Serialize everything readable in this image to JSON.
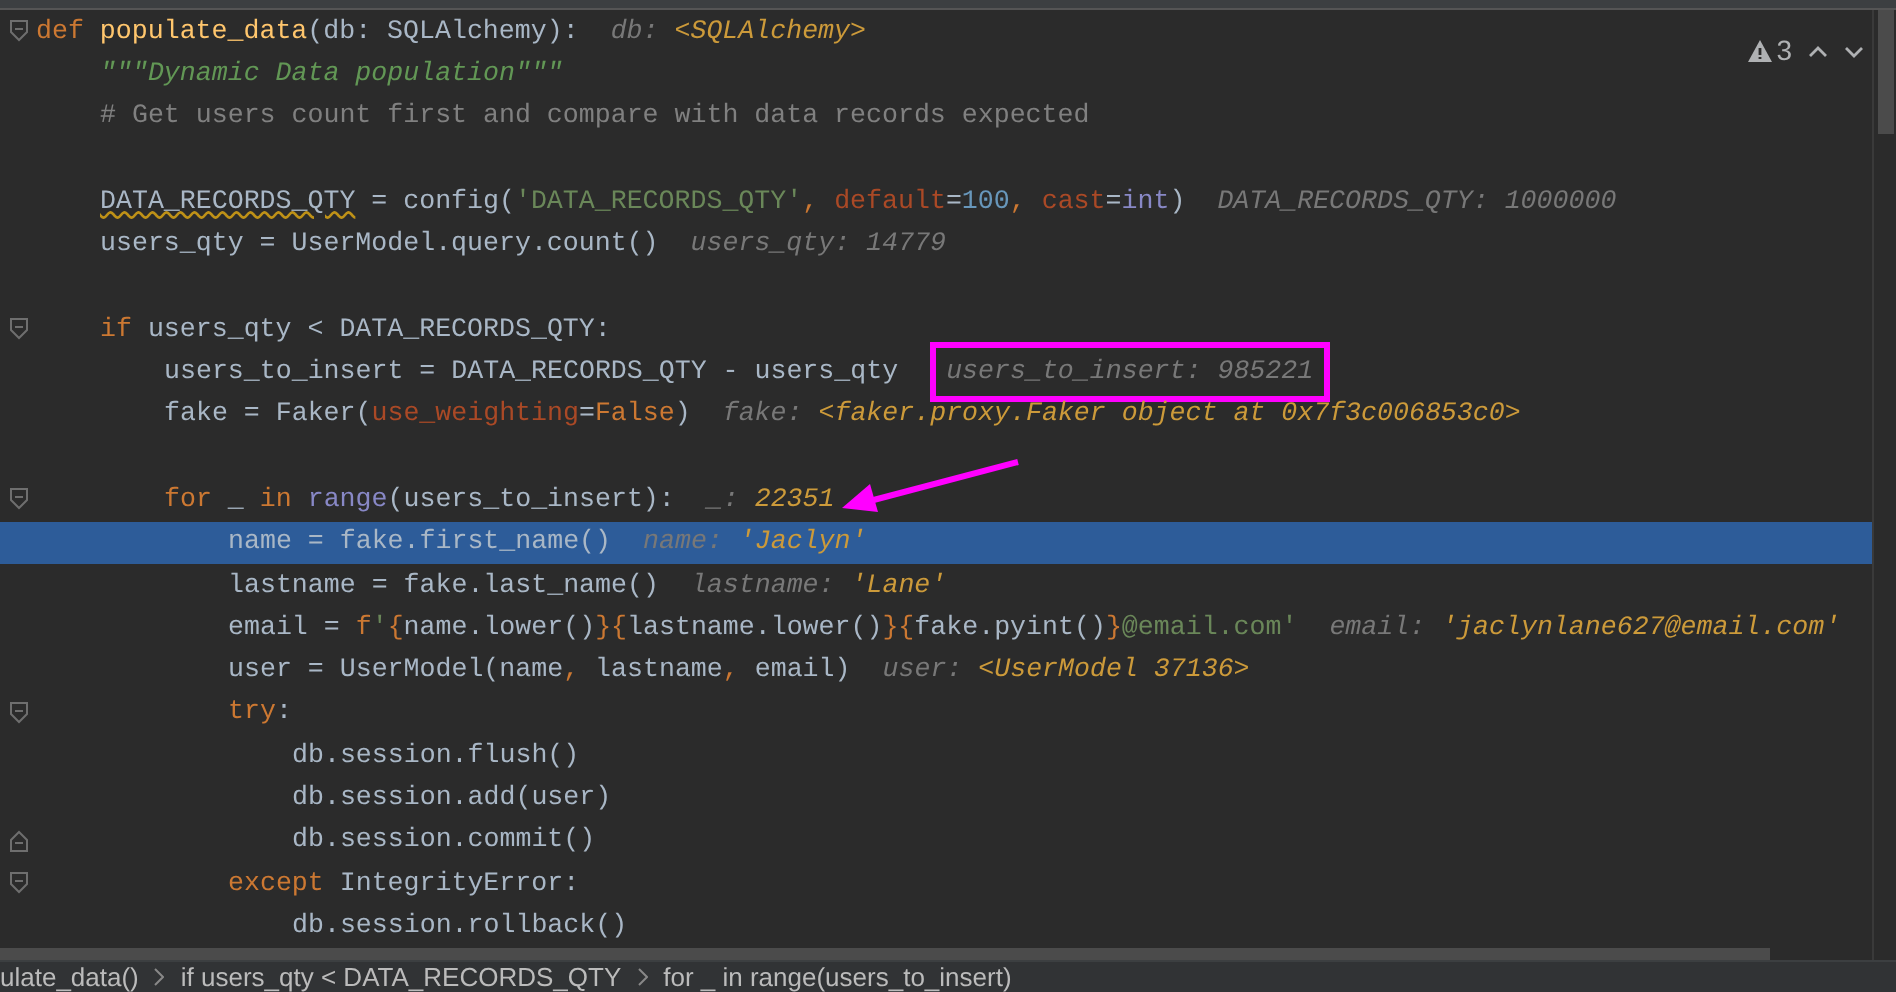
{
  "inspections": {
    "count": "3"
  },
  "lines": [
    {
      "kind": "code",
      "fold_end": false,
      "current": false,
      "tokens": [
        {
          "kind": "keyword",
          "text": "def "
        },
        {
          "kind": "function",
          "text": "populate_data"
        },
        {
          "kind": "plain",
          "text": "(db: SQLAlchemy):"
        }
      ],
      "hint": {
        "boxed": false,
        "arrow": false,
        "parts": [
          {
            "kind": "label",
            "text": "db: "
          },
          {
            "kind": "value",
            "text": "<SQLAlchemy>"
          }
        ]
      },
      "children": [
        {
          "kind": "code",
          "fold_end": false,
          "current": false,
          "tokens": [
            {
              "kind": "docstring",
              "text": "\"\"\"Dynamic Data population\"\"\""
            }
          ]
        },
        {
          "kind": "code",
          "fold_end": false,
          "current": false,
          "tokens": [
            {
              "kind": "comment",
              "text": "# Get users count first and compare with data records expected"
            }
          ]
        },
        {
          "kind": "blank"
        },
        {
          "kind": "code",
          "fold_end": false,
          "current": false,
          "tokens": [
            {
              "kind": "warning",
              "text": "DATA_RECORDS_QTY"
            },
            {
              "kind": "plain",
              "text": " = config("
            },
            {
              "kind": "string",
              "text": "'DATA_RECORDS_QTY'"
            },
            {
              "kind": "keyword",
              "text": ", "
            },
            {
              "kind": "param",
              "text": "default"
            },
            {
              "kind": "plain",
              "text": "="
            },
            {
              "kind": "number",
              "text": "100"
            },
            {
              "kind": "keyword",
              "text": ", "
            },
            {
              "kind": "param",
              "text": "cast"
            },
            {
              "kind": "plain",
              "text": "="
            },
            {
              "kind": "builtin",
              "text": "int"
            },
            {
              "kind": "plain",
              "text": ")"
            }
          ],
          "hint": {
            "boxed": false,
            "arrow": false,
            "parts": [
              {
                "kind": "label",
                "text": "DATA_RECORDS_QTY: 1000000"
              }
            ]
          }
        },
        {
          "kind": "code",
          "fold_end": false,
          "current": false,
          "tokens": [
            {
              "kind": "plain",
              "text": "users_qty = UserModel.query.count()"
            }
          ],
          "hint": {
            "boxed": false,
            "arrow": false,
            "parts": [
              {
                "kind": "label",
                "text": "users_qty: 14779"
              }
            ]
          }
        },
        {
          "kind": "blank"
        },
        {
          "kind": "code",
          "fold_end": false,
          "current": false,
          "tokens": [
            {
              "kind": "keyword",
              "text": "if "
            },
            {
              "kind": "plain",
              "text": "users_qty < DATA_RECORDS_QTY:"
            }
          ],
          "children": [
            {
              "kind": "code",
              "fold_end": false,
              "current": false,
              "tokens": [
                {
                  "kind": "plain",
                  "text": "users_to_insert = DATA_RECORDS_QTY - users_qty"
                }
              ],
              "hint": {
                "boxed": true,
                "arrow": false,
                "parts": [
                  {
                    "kind": "label",
                    "text": "users_to_insert: 985221"
                  }
                ]
              }
            },
            {
              "kind": "code",
              "fold_end": false,
              "current": false,
              "tokens": [
                {
                  "kind": "plain",
                  "text": "fake = Faker("
                },
                {
                  "kind": "param",
                  "text": "use_weighting"
                },
                {
                  "kind": "plain",
                  "text": "="
                },
                {
                  "kind": "keyword",
                  "text": "False"
                },
                {
                  "kind": "plain",
                  "text": ")"
                }
              ],
              "hint": {
                "boxed": false,
                "arrow": false,
                "parts": [
                  {
                    "kind": "label",
                    "text": "fake: "
                  },
                  {
                    "kind": "value",
                    "text": "<faker.proxy.Faker object at 0x7f3c006853c0>"
                  }
                ]
              }
            },
            {
              "kind": "blank"
            },
            {
              "kind": "code",
              "fold_end": false,
              "current": false,
              "tokens": [
                {
                  "kind": "keyword",
                  "text": "for "
                },
                {
                  "kind": "plain",
                  "text": "_ "
                },
                {
                  "kind": "keyword",
                  "text": "in "
                },
                {
                  "kind": "builtin",
                  "text": "range"
                },
                {
                  "kind": "plain",
                  "text": "(users_to_insert):"
                }
              ],
              "hint": {
                "boxed": false,
                "arrow": true,
                "parts": [
                  {
                    "kind": "label",
                    "text": "_: "
                  },
                  {
                    "kind": "value",
                    "text": "22351"
                  }
                ]
              },
              "children": [
                {
                  "kind": "code",
                  "fold_end": false,
                  "current": true,
                  "tokens": [
                    {
                      "kind": "plain",
                      "text": "name = fake.first_name()"
                    }
                  ],
                  "hint": {
                    "boxed": false,
                    "arrow": false,
                    "parts": [
                      {
                        "kind": "label",
                        "text": "name: "
                      },
                      {
                        "kind": "value",
                        "text": "'Jaclyn'"
                      }
                    ]
                  }
                },
                {
                  "kind": "code",
                  "fold_end": false,
                  "current": false,
                  "tokens": [
                    {
                      "kind": "plain",
                      "text": "lastname = fake.last_name()"
                    }
                  ],
                  "hint": {
                    "boxed": false,
                    "arrow": false,
                    "parts": [
                      {
                        "kind": "label",
                        "text": "lastname: "
                      },
                      {
                        "kind": "value",
                        "text": "'Lane'"
                      }
                    ]
                  }
                },
                {
                  "kind": "code",
                  "fold_end": false,
                  "current": false,
                  "tokens": [
                    {
                      "kind": "plain",
                      "text": "email = "
                    },
                    {
                      "kind": "keyword",
                      "text": "f"
                    },
                    {
                      "kind": "string",
                      "text": "'"
                    },
                    {
                      "kind": "keyword",
                      "text": "{"
                    },
                    {
                      "kind": "plain",
                      "text": "name.lower()"
                    },
                    {
                      "kind": "keyword",
                      "text": "}{"
                    },
                    {
                      "kind": "plain",
                      "text": "lastname.lower()"
                    },
                    {
                      "kind": "keyword",
                      "text": "}{"
                    },
                    {
                      "kind": "plain",
                      "text": "fake.pyint()"
                    },
                    {
                      "kind": "keyword",
                      "text": "}"
                    },
                    {
                      "kind": "string",
                      "text": "@email.com'"
                    }
                  ],
                  "hint": {
                    "boxed": false,
                    "arrow": false,
                    "parts": [
                      {
                        "kind": "label",
                        "text": "email: "
                      },
                      {
                        "kind": "value",
                        "text": "'jaclynlane627@email.com'"
                      }
                    ]
                  }
                },
                {
                  "kind": "code",
                  "fold_end": false,
                  "current": false,
                  "tokens": [
                    {
                      "kind": "plain",
                      "text": "user = UserModel(name"
                    },
                    {
                      "kind": "keyword",
                      "text": ", "
                    },
                    {
                      "kind": "plain",
                      "text": "lastname"
                    },
                    {
                      "kind": "keyword",
                      "text": ", "
                    },
                    {
                      "kind": "plain",
                      "text": "email)"
                    }
                  ],
                  "hint": {
                    "boxed": false,
                    "arrow": false,
                    "parts": [
                      {
                        "kind": "label",
                        "text": "user: "
                      },
                      {
                        "kind": "value",
                        "text": "<UserModel 37136>"
                      }
                    ]
                  }
                },
                {
                  "kind": "code",
                  "fold_end": false,
                  "current": false,
                  "tokens": [
                    {
                      "kind": "keyword",
                      "text": "try"
                    },
                    {
                      "kind": "plain",
                      "text": ":"
                    }
                  ],
                  "children": [
                    {
                      "kind": "code",
                      "fold_end": false,
                      "current": false,
                      "tokens": [
                        {
                          "kind": "plain",
                          "text": "db.session.flush()"
                        }
                      ]
                    },
                    {
                      "kind": "code",
                      "fold_end": false,
                      "current": false,
                      "tokens": [
                        {
                          "kind": "plain",
                          "text": "db.session.add(user)"
                        }
                      ]
                    },
                    {
                      "kind": "code",
                      "fold_end": true,
                      "current": false,
                      "tokens": [
                        {
                          "kind": "plain",
                          "text": "db.session.commit()"
                        }
                      ]
                    }
                  ]
                },
                {
                  "kind": "code",
                  "fold_end": false,
                  "current": false,
                  "tokens": [
                    {
                      "kind": "keyword",
                      "text": "except "
                    },
                    {
                      "kind": "plain",
                      "text": "IntegrityError:"
                    }
                  ],
                  "children": [
                    {
                      "kind": "code",
                      "fold_end": false,
                      "current": false,
                      "tokens": [
                        {
                          "kind": "plain",
                          "text": "db.session.rollback()"
                        }
                      ]
                    }
                  ]
                }
              ]
            }
          ]
        }
      ]
    }
  ],
  "breadcrumbs": [
    "ulate_data()",
    "if users_qty < DATA_RECORDS_QTY",
    "for _ in range(users_to_insert)"
  ]
}
